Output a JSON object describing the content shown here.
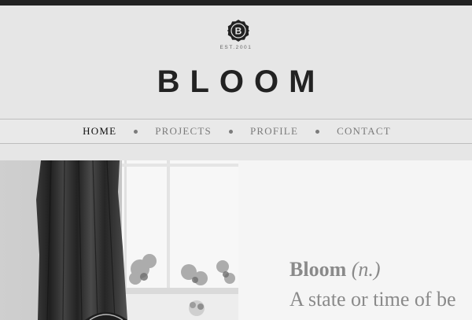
{
  "header": {
    "badge_letter": "B",
    "established": "EST.2001",
    "logo": "BLOOM"
  },
  "nav": {
    "items": [
      {
        "label": "HOME",
        "active": true
      },
      {
        "label": "PROJECTS",
        "active": false
      },
      {
        "label": "PROFILE",
        "active": false
      },
      {
        "label": "CONTACT",
        "active": false
      }
    ]
  },
  "hero": {
    "image_alt": "photo-window-curtain",
    "term": "Bloom",
    "part_of_speech": "(n.)",
    "definition": "A state or time of be"
  },
  "colors": {
    "topbar": "#222222",
    "background": "#e6e6e6",
    "nav_active": "#111111",
    "nav_inactive": "#7b7b7b",
    "hero_text": "#8a8a8a"
  }
}
